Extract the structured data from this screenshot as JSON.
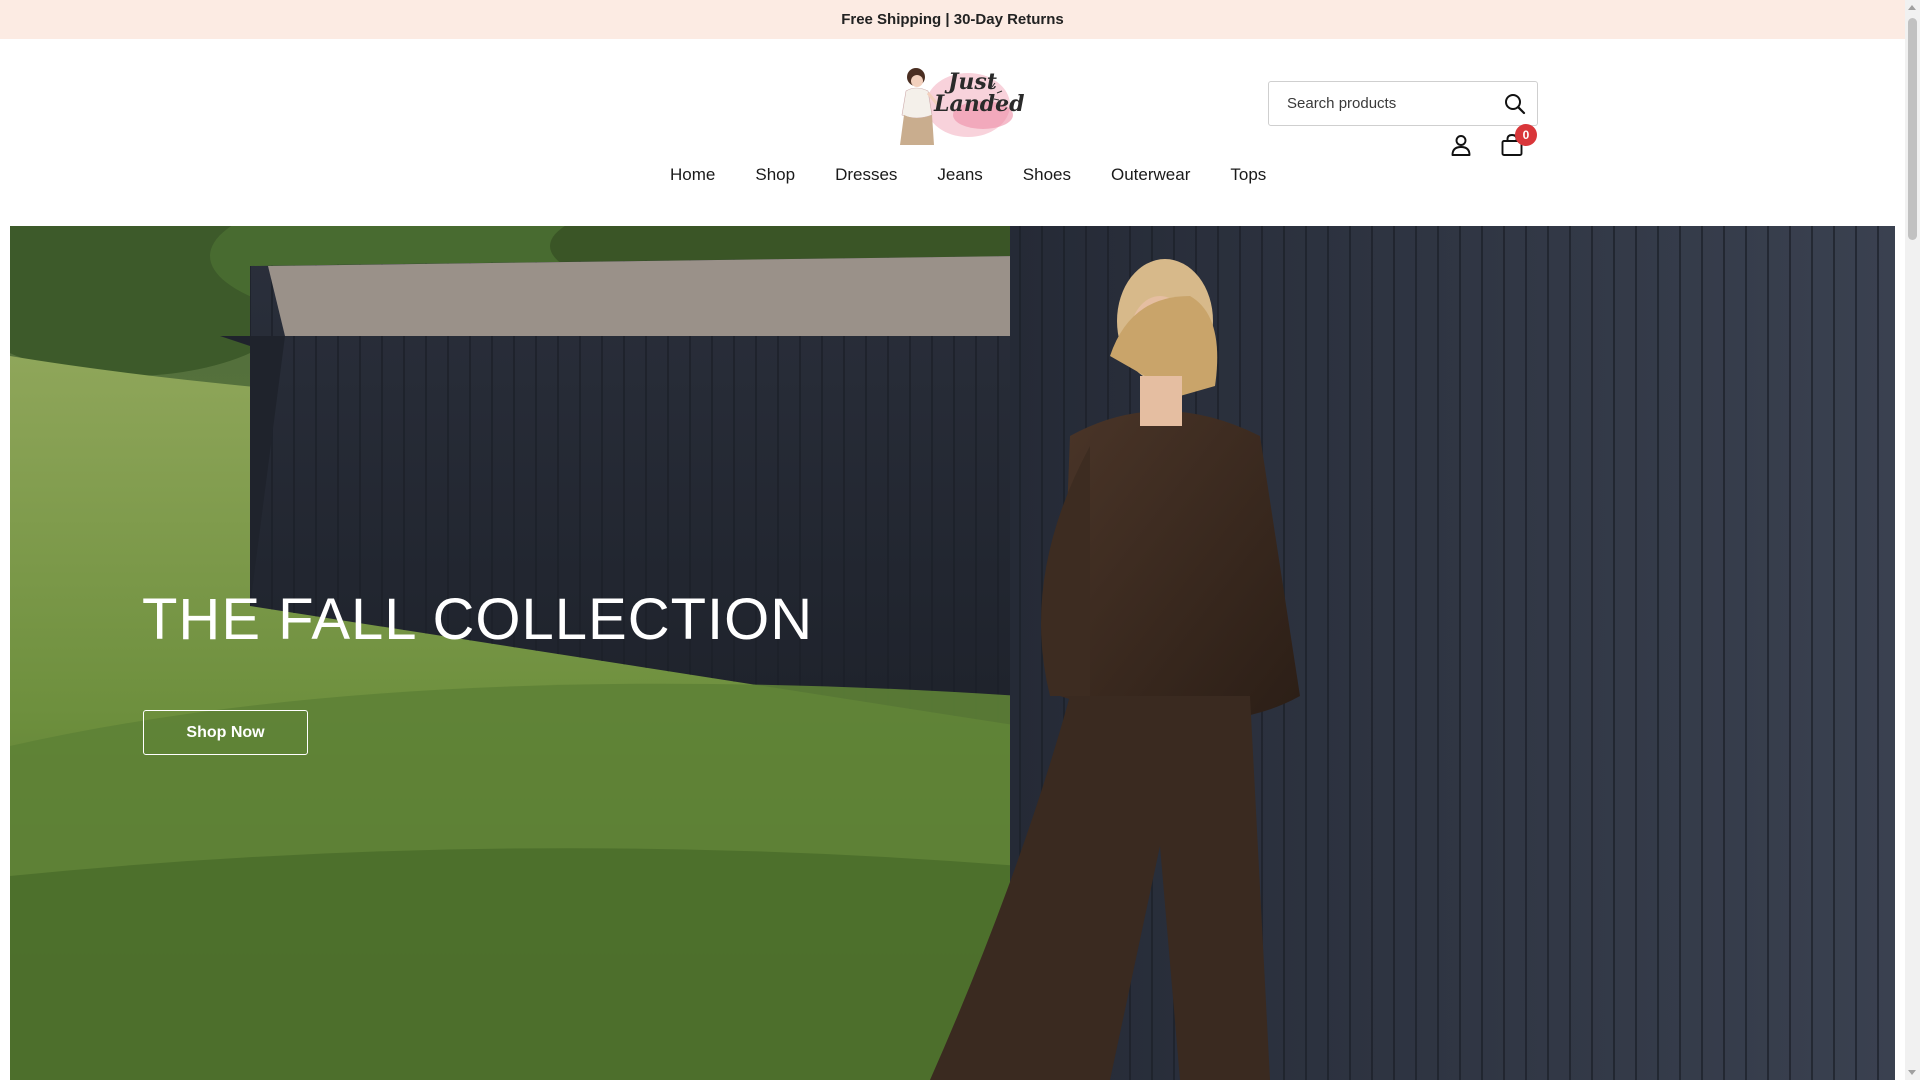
{
  "announcement": {
    "text": "Free Shipping | 30-Day Returns"
  },
  "brand": {
    "logo_text_line1": "Just",
    "logo_text_line2": "Landed",
    "logo_color": "#f2a7b8"
  },
  "search": {
    "placeholder": "Search products",
    "icon": "search-icon"
  },
  "nav": {
    "items": [
      {
        "label": "Home"
      },
      {
        "label": "Shop"
      },
      {
        "label": "Dresses"
      },
      {
        "label": "Jeans"
      },
      {
        "label": "Shoes"
      },
      {
        "label": "Outerwear"
      },
      {
        "label": "Tops"
      }
    ]
  },
  "header_icons": {
    "account_icon": "user-icon",
    "cart_icon": "shopping-bag-icon",
    "cart_count": "0",
    "badge_color": "#d9363a"
  },
  "hero": {
    "title": "THE FALL COLLECTION",
    "button_label": "Shop Now"
  },
  "colors": {
    "announcement_bg": "#fcebe3",
    "text": "#1a1a1a"
  }
}
